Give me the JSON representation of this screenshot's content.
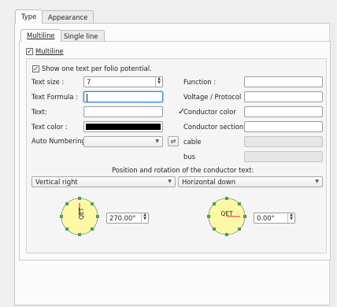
{
  "tabs": {
    "type": "Type",
    "appearance": "Appearance"
  },
  "subtabs": {
    "multiline": "Multiline",
    "single_line": "Single line"
  },
  "multiline_checkbox": {
    "label": "Multiline",
    "checked": "✓"
  },
  "one_text_checkbox": {
    "label": "Show one text per folio potential.",
    "checked": "✓"
  },
  "left_fields": {
    "text_size_label": "Text size :",
    "text_size_value": "7",
    "text_formula_label": "Text Formula :",
    "text_label": "Text:",
    "text_color_label": "Text color :",
    "text_color_value": "#000000",
    "auto_numbering_label": "Auto Numbering"
  },
  "right_fields": {
    "function_label": "Function :",
    "voltage_label": "Voltage / Protocol :",
    "conductor_color_label": "Conductor color",
    "conductor_color_check": "✓",
    "conductor_section_label": "Conductor section",
    "cable_label": "cable",
    "bus_label": "bus"
  },
  "position_title": "Position and rotation of the conductor text:",
  "vertical_combo": "Vertical right",
  "horizontal_combo": "Horizontal down",
  "dial_left": {
    "text": "QET",
    "angle_value": "270.00°"
  },
  "dial_right": {
    "text": "QET",
    "angle_value": "0.00°"
  },
  "colors": {
    "dial_fill": "#fdf8a6",
    "dial_dot": "#3da84b",
    "dial_line": "#e0232b"
  }
}
